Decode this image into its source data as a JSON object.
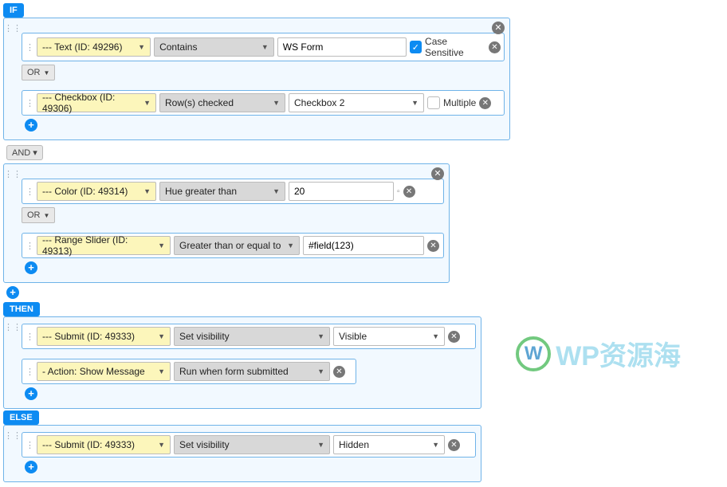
{
  "labels": {
    "if": "IF",
    "and": "AND",
    "then": "THEN",
    "else": "ELSE",
    "or": "OR"
  },
  "if": {
    "g1": {
      "r1": {
        "field": "--- Text (ID: 49296)",
        "op": "Contains",
        "val": "WS Form",
        "case_label": "Case Sensitive"
      },
      "r2": {
        "field": "--- Checkbox (ID: 49306)",
        "op": "Row(s) checked",
        "val": "Checkbox 2",
        "multi_label": "Multiple"
      }
    },
    "g2": {
      "r1": {
        "field": "--- Color (ID: 49314)",
        "op": "Hue greater than",
        "val": "20"
      },
      "r2": {
        "field": "--- Range Slider (ID: 49313)",
        "op": "Greater than or equal to",
        "val": "#field(123)"
      }
    }
  },
  "then": {
    "r1": {
      "field": "--- Submit (ID: 49333)",
      "op": "Set visibility",
      "val": "Visible"
    },
    "r2": {
      "field": "- Action: Show Message",
      "op": "Run when form submitted"
    }
  },
  "else": {
    "r1": {
      "field": "--- Submit (ID: 49333)",
      "op": "Set visibility",
      "val": "Hidden"
    }
  },
  "watermark": "WP资源海"
}
